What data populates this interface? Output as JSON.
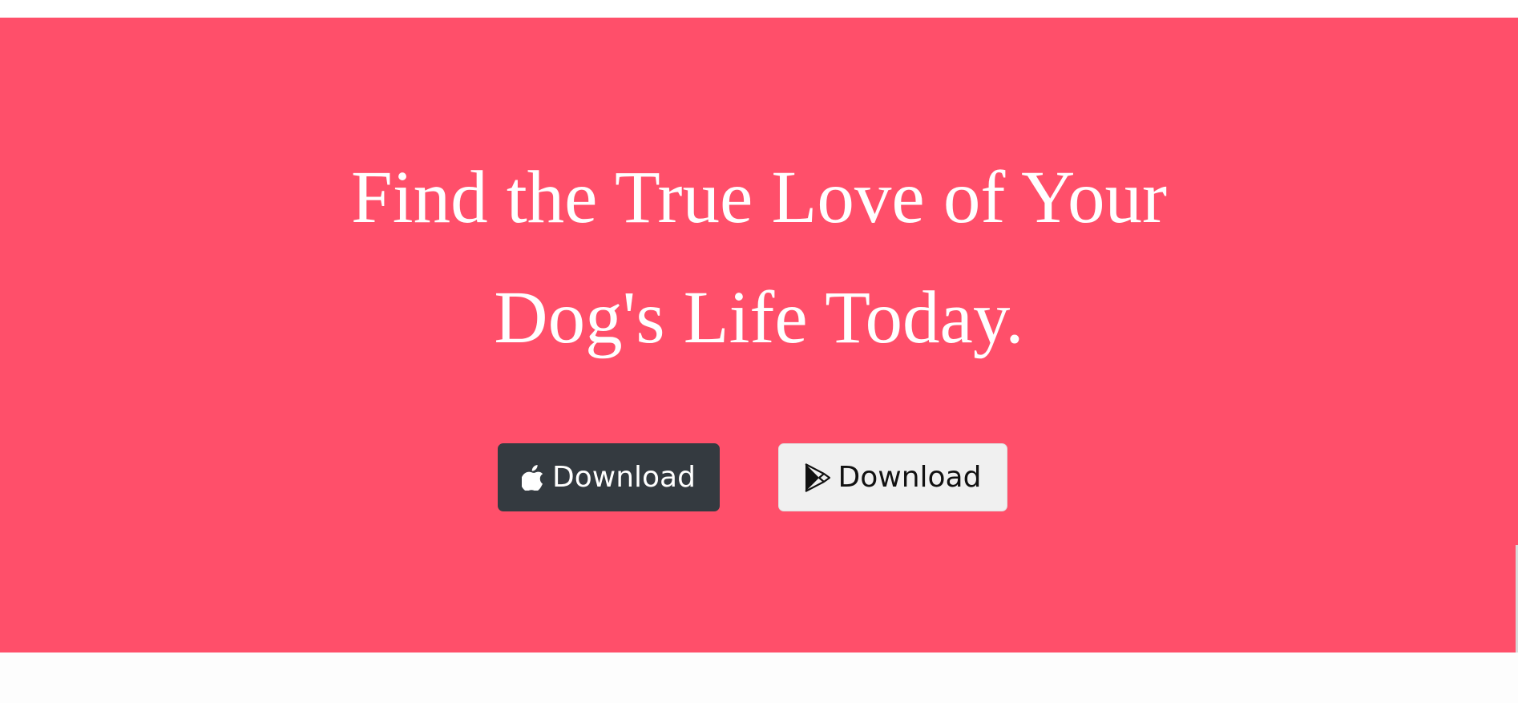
{
  "hero": {
    "background_color": "#ff4f6a",
    "headline_line1": "Find the True Love of Your",
    "headline_line2": "Dog's Life Today.",
    "buttons": [
      {
        "label": "Download",
        "icon": "apple-icon",
        "background_color": "#343a40",
        "text_color": "#ffffff"
      },
      {
        "label": "Download",
        "icon": "google-play-icon",
        "background_color": "#f0f0f0",
        "text_color": "#111111"
      }
    ]
  }
}
